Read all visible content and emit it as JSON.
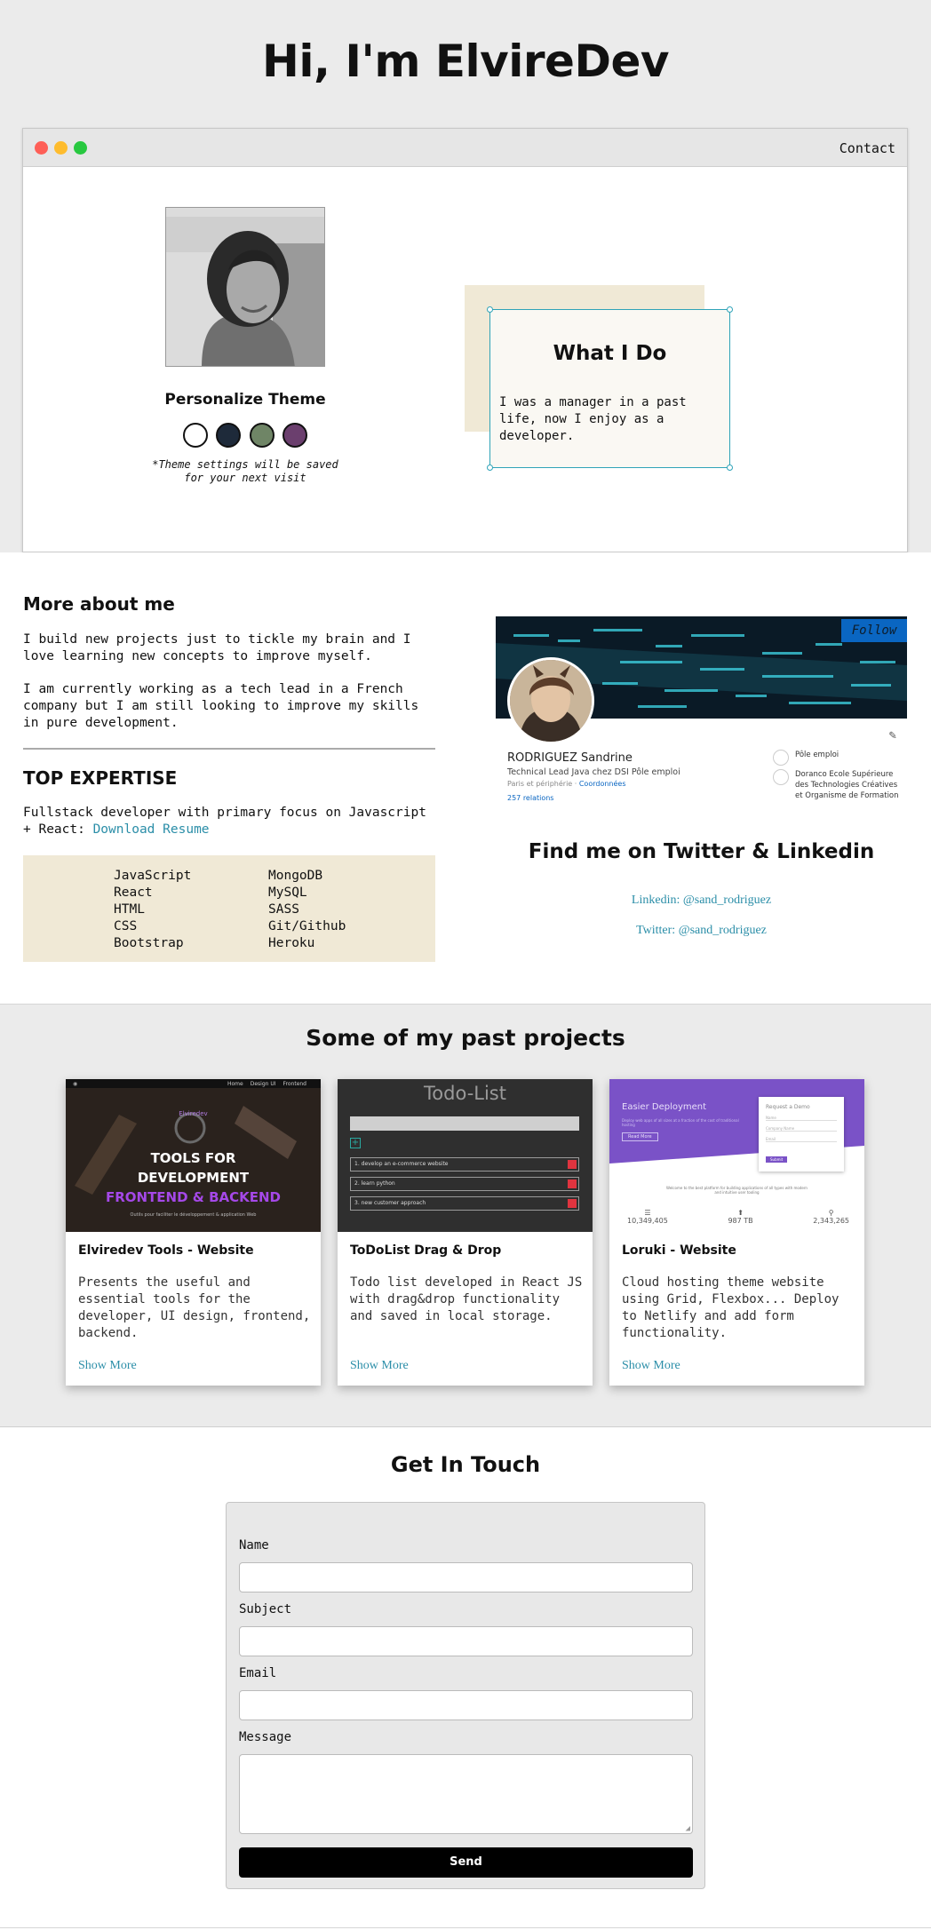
{
  "hero": {
    "title": "Hi, I'm ElvireDev"
  },
  "window": {
    "contact_label": "Contact"
  },
  "theme": {
    "title": "Personalize Theme",
    "note": "*Theme settings will be saved for your next visit",
    "swatches": [
      "#ffffff",
      "#1e2a3a",
      "#6f8566",
      "#6b3f6e"
    ]
  },
  "whatido": {
    "title": "What I Do",
    "text": "I was a manager in a past life, now I enjoy as a developer."
  },
  "about": {
    "title": "More about me",
    "p1": "I build new projects just to tickle my brain and I love learning new concepts to improve myself.",
    "p2": "I am currently working as a tech lead in a French company but I am still looking to improve my skills in pure development.",
    "expertise_title": "TOP EXPERTISE",
    "expertise_text": "Fullstack developer with primary focus on Javascript + React:",
    "resume_link": "Download Resume",
    "skills_left": [
      "JavaScript",
      "React",
      "HTML",
      "CSS",
      "Bootstrap"
    ],
    "skills_right": [
      "MongoDB",
      "MySQL",
      "SASS",
      "Git/Github",
      "Heroku"
    ]
  },
  "linkedin": {
    "follow_label": "Follow",
    "name": "RODRIGUEZ Sandrine",
    "headline": "Technical Lead Java chez DSI Pôle emploi",
    "location": "Paris et périphérie · ",
    "contact_info": "Coordonnées",
    "connections": "257 relations",
    "company1": "Pôle emploi",
    "company2": "Doranco Ecole Supérieure des Technologies Créatives et Organisme de Formation"
  },
  "social": {
    "title": "Find me on Twitter & Linkedin",
    "linkedin": "Linkedin: @sand_rodriguez",
    "twitter": "Twitter: @sand_rodriguez"
  },
  "projects": {
    "title": "Some of my past projects",
    "items": [
      {
        "title": "Elviredev Tools - Website",
        "desc": "Presents the useful and essential tools for the developer, UI design, frontend, backend.",
        "link": "Show More",
        "thumb": {
          "brand": "Elviredev",
          "nav": [
            "Home",
            "Design UI",
            "Frontend"
          ],
          "line1": "TOOLS FOR",
          "line2": "DEVELOPMENT",
          "line3": "FRONTEND & BACKEND",
          "caption": "Outils pour faciliter le développement & application Web"
        }
      },
      {
        "title": "ToDoList Drag & Drop",
        "desc": "Todo list developed in React JS with drag&drop functionality and saved in local storage.",
        "link": "Show More",
        "thumb": {
          "heading": "Todo-List",
          "add": "+",
          "items": [
            "1. develop an e-commerce website",
            "2. learn python",
            "3. new customer approach"
          ]
        }
      },
      {
        "title": "Loruki - Website",
        "desc": "Cloud hosting theme website using Grid, Flexbox... Deploy to Netlify and add form functionality.",
        "link": "Show More",
        "thumb": {
          "hero": "Easier Deployment",
          "blurb": "Deploy web apps of all sizes at a fraction of the cost of traditional hosting",
          "cta": "Read More",
          "form_title": "Request a Demo",
          "fields": [
            "Name",
            "Company Name",
            "Email"
          ],
          "submit": "Submit",
          "tagline": "Welcome to the best platform for building applications of all types with modern and intuitive user tooling",
          "stats": [
            "10,349,405",
            "987 TB",
            "2,343,265"
          ]
        }
      }
    ]
  },
  "contact": {
    "title": "Get In Touch",
    "name_label": "Name",
    "subject_label": "Subject",
    "email_label": "Email",
    "message_label": "Message",
    "send_label": "Send"
  }
}
